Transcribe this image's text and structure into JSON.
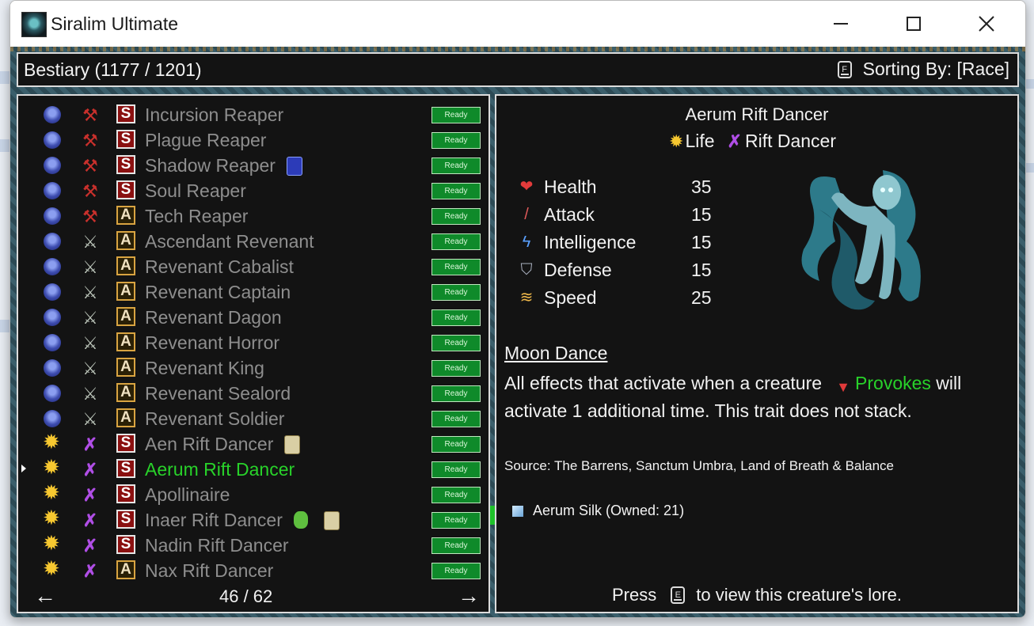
{
  "window": {
    "title": "Siralim Ultimate"
  },
  "header": {
    "title": "Bestiary (1177 / 1201)",
    "sort_key": "F",
    "sort_label": "Sorting By: [Race]"
  },
  "list": {
    "items": [
      {
        "race_icon": "lich-race-icon",
        "class_icon": "reaper-scythe-icon",
        "rarity": "S",
        "name": "Incursion Reaper",
        "status": "Ready"
      },
      {
        "race_icon": "lich-race-icon",
        "class_icon": "reaper-scythe-icon",
        "rarity": "S",
        "name": "Plague Reaper",
        "status": "Ready"
      },
      {
        "race_icon": "lich-race-icon",
        "class_icon": "reaper-scythe-icon",
        "rarity": "S",
        "name": "Shadow Reaper",
        "status": "Ready",
        "badge": "blue-card-icon"
      },
      {
        "race_icon": "lich-race-icon",
        "class_icon": "reaper-scythe-icon",
        "rarity": "S",
        "name": "Soul Reaper",
        "status": "Ready"
      },
      {
        "race_icon": "lich-race-icon",
        "class_icon": "reaper-scythe-icon",
        "rarity": "A",
        "name": "Tech Reaper",
        "status": "Ready"
      },
      {
        "race_icon": "lich-race-icon",
        "class_icon": "trident-icon",
        "rarity": "A",
        "name": "Ascendant Revenant",
        "status": "Ready"
      },
      {
        "race_icon": "lich-race-icon",
        "class_icon": "trident-icon",
        "rarity": "A",
        "name": "Revenant Cabalist",
        "status": "Ready"
      },
      {
        "race_icon": "lich-race-icon",
        "class_icon": "trident-icon",
        "rarity": "A",
        "name": "Revenant Captain",
        "status": "Ready"
      },
      {
        "race_icon": "lich-race-icon",
        "class_icon": "trident-icon",
        "rarity": "A",
        "name": "Revenant Dagon",
        "status": "Ready"
      },
      {
        "race_icon": "lich-race-icon",
        "class_icon": "trident-icon",
        "rarity": "A",
        "name": "Revenant Horror",
        "status": "Ready"
      },
      {
        "race_icon": "lich-race-icon",
        "class_icon": "trident-icon",
        "rarity": "A",
        "name": "Revenant King",
        "status": "Ready"
      },
      {
        "race_icon": "lich-race-icon",
        "class_icon": "trident-icon",
        "rarity": "A",
        "name": "Revenant Sealord",
        "status": "Ready"
      },
      {
        "race_icon": "lich-race-icon",
        "class_icon": "trident-icon",
        "rarity": "A",
        "name": "Revenant Soldier",
        "status": "Ready"
      },
      {
        "race_icon": "life-sun-icon",
        "class_icon": "rift-dancer-icon",
        "rarity": "S",
        "name": "Aen Rift Dancer",
        "status": "Ready",
        "badge": "card-icon"
      },
      {
        "race_icon": "life-sun-icon",
        "class_icon": "rift-dancer-icon",
        "rarity": "S",
        "name": "Aerum Rift Dancer",
        "status": "Ready",
        "selected": true
      },
      {
        "race_icon": "life-sun-icon",
        "class_icon": "rift-dancer-icon",
        "rarity": "S",
        "name": "Apollinaire",
        "status": "Ready"
      },
      {
        "race_icon": "life-sun-icon",
        "class_icon": "rift-dancer-icon",
        "rarity": "S",
        "name": "Inaer Rift Dancer",
        "status": "Ready",
        "badge": "goblin-icon",
        "badge2": "card-icon"
      },
      {
        "race_icon": "life-sun-icon",
        "class_icon": "rift-dancer-icon",
        "rarity": "S",
        "name": "Nadin Rift Dancer",
        "status": "Ready"
      },
      {
        "race_icon": "life-sun-icon",
        "class_icon": "rift-dancer-icon",
        "rarity": "A",
        "name": "Nax Rift Dancer",
        "status": "Ready"
      }
    ],
    "page": "46 / 62",
    "prev_arrow": "←",
    "next_arrow": "→"
  },
  "detail": {
    "name": "Aerum Rift Dancer",
    "element": "Life",
    "class": "Rift Dancer",
    "stats": [
      {
        "icon": "heart-icon",
        "label": "Health",
        "value": "35"
      },
      {
        "icon": "sword-icon",
        "label": "Attack",
        "value": "15"
      },
      {
        "icon": "lightning-icon",
        "label": "Intelligence",
        "value": "15"
      },
      {
        "icon": "shield-icon",
        "label": "Defense",
        "value": "15"
      },
      {
        "icon": "wing-icon",
        "label": "Speed",
        "value": "25"
      }
    ],
    "trait_name": "Moon Dance",
    "trait_desc_1": "All effects that activate when a creature",
    "trait_keyword": "Provokes",
    "trait_desc_2": " will activate 1 additional time. This trait does not stack.",
    "source": "Source: The Barrens, Sanctum Umbra, Land of Breath & Balance",
    "material": "Aerum Silk (Owned: 21)",
    "lore_press": "Press",
    "lore_key": "E",
    "lore_rest": "to view this creature's lore."
  },
  "colors": {
    "selected": "#28d22a",
    "ready_bg": "#0f8a2a",
    "panel_bg": "#131313"
  }
}
